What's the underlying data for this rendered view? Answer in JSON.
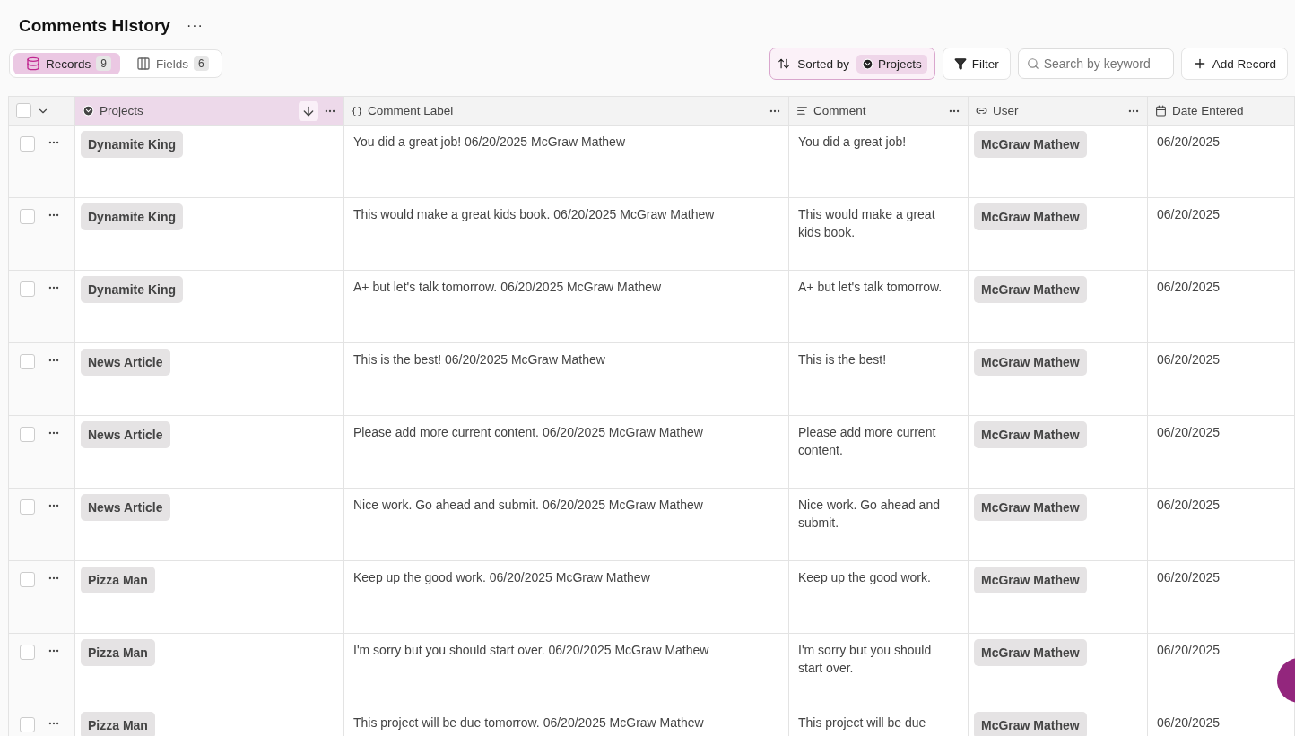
{
  "page": {
    "title": "Comments History",
    "menu": "···"
  },
  "view_tabs": [
    {
      "kind": "records",
      "label": "Records",
      "count": "9",
      "selected": true
    },
    {
      "kind": "fields",
      "label": "Fields",
      "count": "6",
      "selected": false
    }
  ],
  "toolbar": {
    "sort": {
      "label": "Sorted by",
      "field": "Projects"
    },
    "filter": "Filter",
    "search": {
      "placeholder": "Search by keyword"
    },
    "add": "Add Record"
  },
  "table": {
    "select_all_checked": false,
    "columns": [
      {
        "kind": "project",
        "label": "Projects",
        "sorted": true
      },
      {
        "kind": "formula",
        "label": "Comment Label",
        "sorted": false
      },
      {
        "kind": "text",
        "label": "Comment",
        "sorted": false
      },
      {
        "kind": "link",
        "label": "User",
        "sorted": false
      },
      {
        "kind": "date",
        "label": "Date Entered",
        "sorted": false
      }
    ],
    "rows": [
      {
        "checked": false,
        "project": "Dynamite King",
        "label": "You did a great job! 06/20/2025 McGraw Mathew",
        "comment": "You did a great job!",
        "user": "McGraw Mathew",
        "date": "06/20/2025"
      },
      {
        "checked": false,
        "project": "Dynamite King",
        "label": "This would make a great kids book. 06/20/2025 McGraw Mathew",
        "comment": "This would make a great kids book.",
        "user": "McGraw Mathew",
        "date": "06/20/2025"
      },
      {
        "checked": false,
        "project": "Dynamite King",
        "label": "A+ but let's talk tomorrow. 06/20/2025 McGraw Mathew",
        "comment": "A+ but let's talk tomorrow.",
        "user": "McGraw Mathew",
        "date": "06/20/2025"
      },
      {
        "checked": false,
        "project": "News Article",
        "label": "This is the best! 06/20/2025 McGraw Mathew",
        "comment": "This is the best!",
        "user": "McGraw Mathew",
        "date": "06/20/2025"
      },
      {
        "checked": false,
        "project": "News Article",
        "label": "Please add more current content. 06/20/2025 McGraw Mathew",
        "comment": "Please add more current content.",
        "user": "McGraw Mathew",
        "date": "06/20/2025"
      },
      {
        "checked": false,
        "project": "News Article",
        "label": "Nice work. Go ahead and submit. 06/20/2025 McGraw Mathew",
        "comment": "Nice work. Go ahead and submit.",
        "user": "McGraw Mathew",
        "date": "06/20/2025"
      },
      {
        "checked": false,
        "project": "Pizza Man",
        "label": "Keep up the good work. 06/20/2025 McGraw Mathew",
        "comment": "Keep up the good work.",
        "user": "McGraw Mathew",
        "date": "06/20/2025"
      },
      {
        "checked": false,
        "project": "Pizza Man",
        "label": "I'm sorry but you should start over. 06/20/2025 McGraw Mathew",
        "comment": "I'm sorry but you should start over.",
        "user": "McGraw Mathew",
        "date": "06/20/2025"
      },
      {
        "checked": false,
        "project": "Pizza Man",
        "label": "This project will be due tomorrow. 06/20/2025 McGraw Mathew",
        "comment": "This project will be due",
        "user": "McGraw Mathew",
        "date": "06/20/2025"
      }
    ]
  }
}
